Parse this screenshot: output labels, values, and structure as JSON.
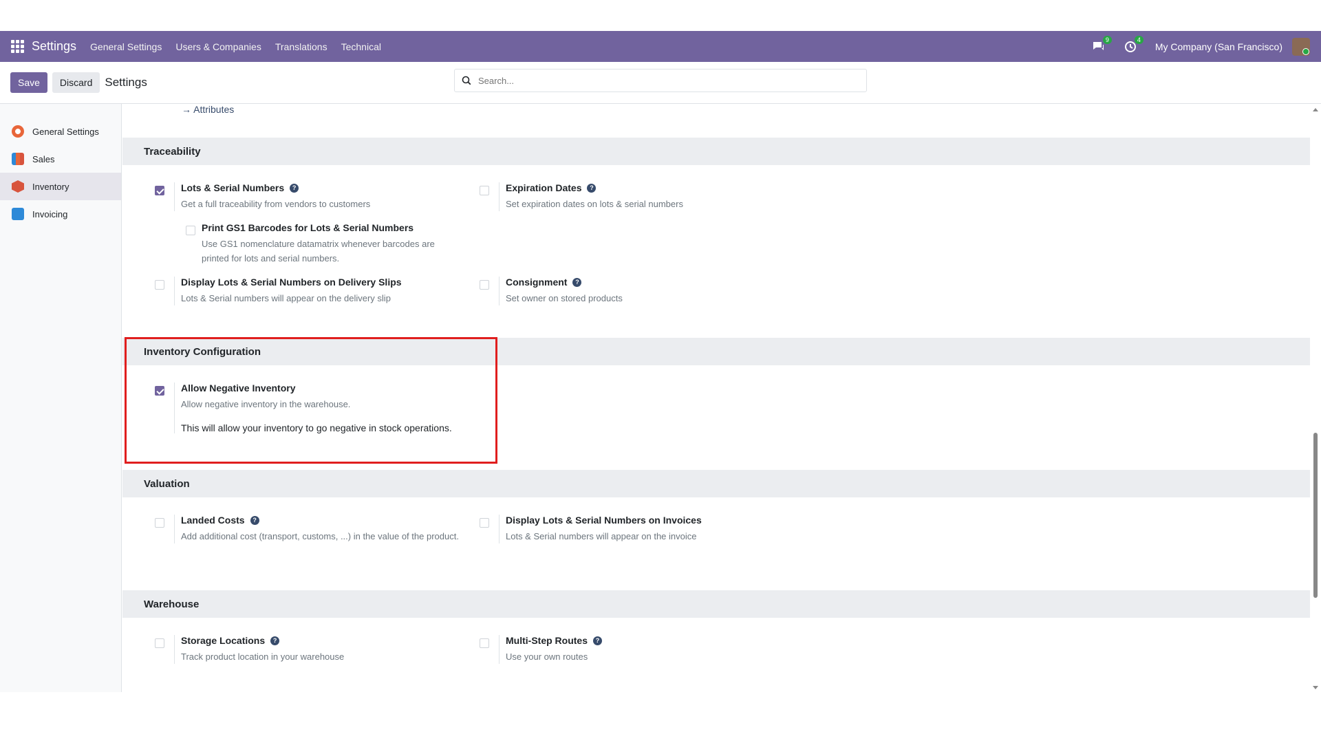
{
  "navbar": {
    "brand": "Settings",
    "menu": [
      "General Settings",
      "Users & Companies",
      "Translations",
      "Technical"
    ],
    "messages_count": "9",
    "activities_count": "4",
    "company": "My Company (San Francisco)"
  },
  "controlbar": {
    "save_label": "Save",
    "discard_label": "Discard",
    "title": "Settings",
    "search_placeholder": "Search..."
  },
  "sidebar": {
    "items": [
      {
        "label": "General Settings",
        "icon": "settings-app-icon",
        "color": "#e8663a"
      },
      {
        "label": "Sales",
        "icon": "sales-app-icon",
        "color": "#e8663a"
      },
      {
        "label": "Inventory",
        "icon": "inventory-app-icon",
        "color": "#d8543d"
      },
      {
        "label": "Invoicing",
        "icon": "invoicing-app-icon",
        "color": "#2e8ad8"
      }
    ]
  },
  "content": {
    "attributes_link": "Attributes",
    "traceability": {
      "heading": "Traceability",
      "lots": {
        "title": "Lots & Serial Numbers",
        "desc": "Get a full traceability from vendors to customers",
        "checked": true
      },
      "gs1": {
        "title": "Print GS1 Barcodes for Lots & Serial Numbers",
        "desc": "Use GS1 nomenclature datamatrix whenever barcodes are printed for lots and serial numbers.",
        "checked": false
      },
      "display_lots": {
        "title": "Display Lots & Serial Numbers on Delivery Slips",
        "desc": "Lots & Serial numbers will appear on the delivery slip",
        "checked": false
      },
      "expiration": {
        "title": "Expiration Dates",
        "desc": "Set expiration dates on lots & serial numbers",
        "checked": false
      },
      "consignment": {
        "title": "Consignment",
        "desc": "Set owner on stored products",
        "checked": false
      }
    },
    "inventory_config": {
      "heading": "Inventory Configuration",
      "negative": {
        "title": "Allow Negative Inventory",
        "desc": "Allow negative inventory in the warehouse.",
        "note": "This will allow your inventory to go negative in stock operations.",
        "checked": true
      }
    },
    "valuation": {
      "heading": "Valuation",
      "landed": {
        "title": "Landed Costs",
        "desc": "Add additional cost (transport, customs, ...) in the value of the product.",
        "checked": false
      },
      "invoice_lots": {
        "title": "Display Lots & Serial Numbers on Invoices",
        "desc": "Lots & Serial numbers will appear on the invoice",
        "checked": false
      }
    },
    "warehouse": {
      "heading": "Warehouse",
      "storage": {
        "title": "Storage Locations",
        "desc": "Track product location in your warehouse",
        "checked": false
      },
      "multistep": {
        "title": "Multi-Step Routes",
        "desc": "Use your own routes",
        "checked": false
      }
    }
  },
  "colors": {
    "brand": "#71639e",
    "highlight": "#e01e1e",
    "badge": "#28a745"
  }
}
